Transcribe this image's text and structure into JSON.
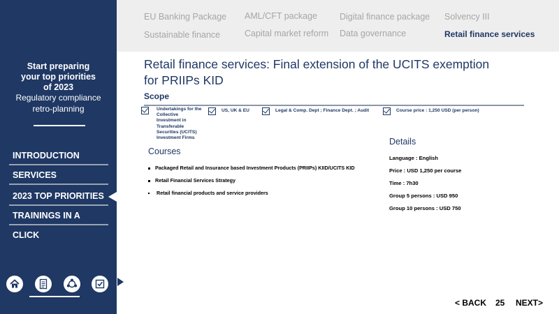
{
  "sidebar": {
    "promo_lines_bold": [
      "Start preparing",
      "your top priorities",
      "of 2023"
    ],
    "promo_lines_light": [
      "Regulatory compliance",
      "retro-planning"
    ],
    "nav": [
      {
        "label": "INTRODUCTION"
      },
      {
        "label": "SERVICES"
      },
      {
        "label": "2023 TOP PRIORITIES"
      },
      {
        "label": "TRAININGS IN A CLICK"
      }
    ],
    "active_nav": "2023 TOP PRIORITIES",
    "icons": [
      "home-icon",
      "document-icon",
      "cycle-icon",
      "checkbox-icon"
    ]
  },
  "tabs": [
    {
      "label": "EU Banking Package"
    },
    {
      "label": "AML/CFT package"
    },
    {
      "label": "Digital finance package"
    },
    {
      "label": "Solvency III"
    },
    {
      "label": "Sustainable finance"
    },
    {
      "label": "Capital market reform"
    },
    {
      "label": "Data governance"
    },
    {
      "label": "Retail finance services"
    }
  ],
  "page": {
    "title_line1": "Retail finance services: Final extension of the UCITS exemption",
    "title_line2": "for PRIIPs KID",
    "scope_label": "Scope"
  },
  "scope_items": [
    {
      "lines": [
        "Undertakings for the",
        "Collective",
        "Investment in",
        "Transferable",
        "Securities (UCITS)",
        "Investment Firms"
      ]
    },
    {
      "lines": [
        "US, UK & EU"
      ]
    },
    {
      "lines": [
        "Legal & Comp. Dept ; Finance Dept. ; Audit"
      ]
    },
    {
      "lines": [
        "Course price : 1,250 USD (per person)"
      ]
    }
  ],
  "courses": {
    "heading": "Courses",
    "items": [
      "Packaged Retail and Insurance based Investment Products (PRIIPs) KIID/UCITS KID",
      "Retail Financial Services Strategy",
      "Retail financial products and service providers"
    ]
  },
  "details": {
    "heading": "Details",
    "items": [
      "Language : English",
      "Price : USD 1,250 per course",
      "Time : 7h30",
      "Group 5 persons : USD 950",
      "Group 10 persons : USD 750"
    ]
  },
  "footer": {
    "back": "< BACK",
    "page_number": "25",
    "next": "NEXT>"
  }
}
